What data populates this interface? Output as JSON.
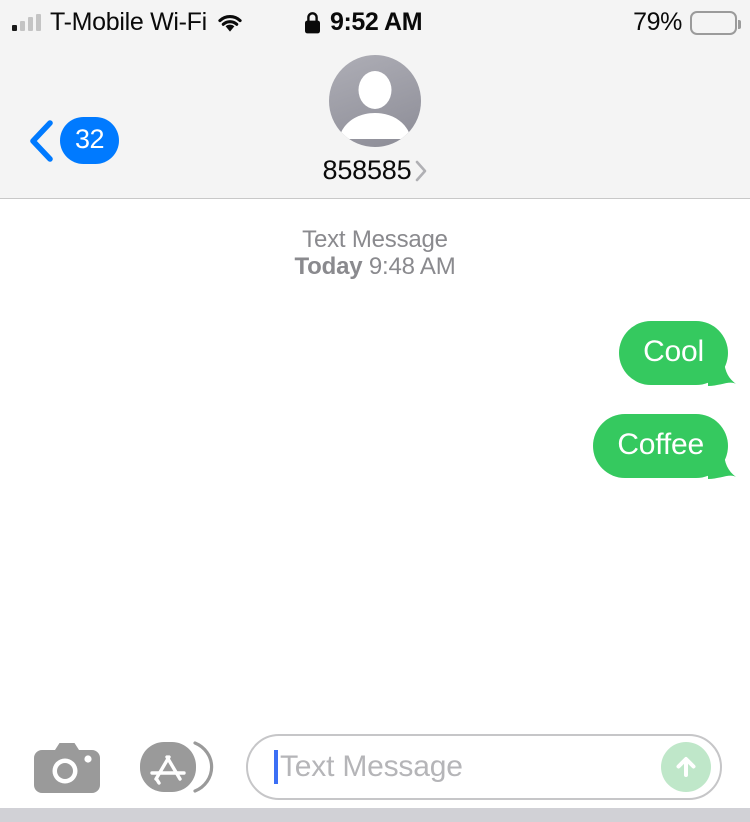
{
  "status_bar": {
    "signal_icon": "cellular-signal-icon",
    "carrier": "T-Mobile Wi-Fi",
    "wifi_icon": "wifi-icon",
    "lock_icon": "lock-icon",
    "time": "9:52 AM",
    "battery_percent": "79%",
    "battery_level": 79,
    "battery_icon": "battery-icon"
  },
  "nav_bar": {
    "back_icon": "chevron-left-icon",
    "back_badge_count": "32",
    "avatar_icon": "person-avatar-icon",
    "contact_name": "858585",
    "contact_detail_icon": "chevron-right-icon",
    "accent_blue": "#007AFF",
    "background": "#F4F4F4"
  },
  "conversation": {
    "service_label": "Text Message",
    "day_label": "Today",
    "time_label": "9:48 AM",
    "bubble_color": "#35C95F",
    "bubble_text_color": "#FFFFFF",
    "messages": [
      {
        "text": "Cool",
        "side": "outgoing",
        "service": "sms"
      },
      {
        "text": "Coffee",
        "side": "outgoing",
        "service": "sms"
      }
    ]
  },
  "toolbar": {
    "camera_icon": "camera-icon",
    "appstore_icon": "app-store-icon",
    "input_value": "",
    "input_placeholder": "Text Message",
    "send_icon": "arrow-up-icon",
    "send_button_color": "#BFE7C9"
  }
}
